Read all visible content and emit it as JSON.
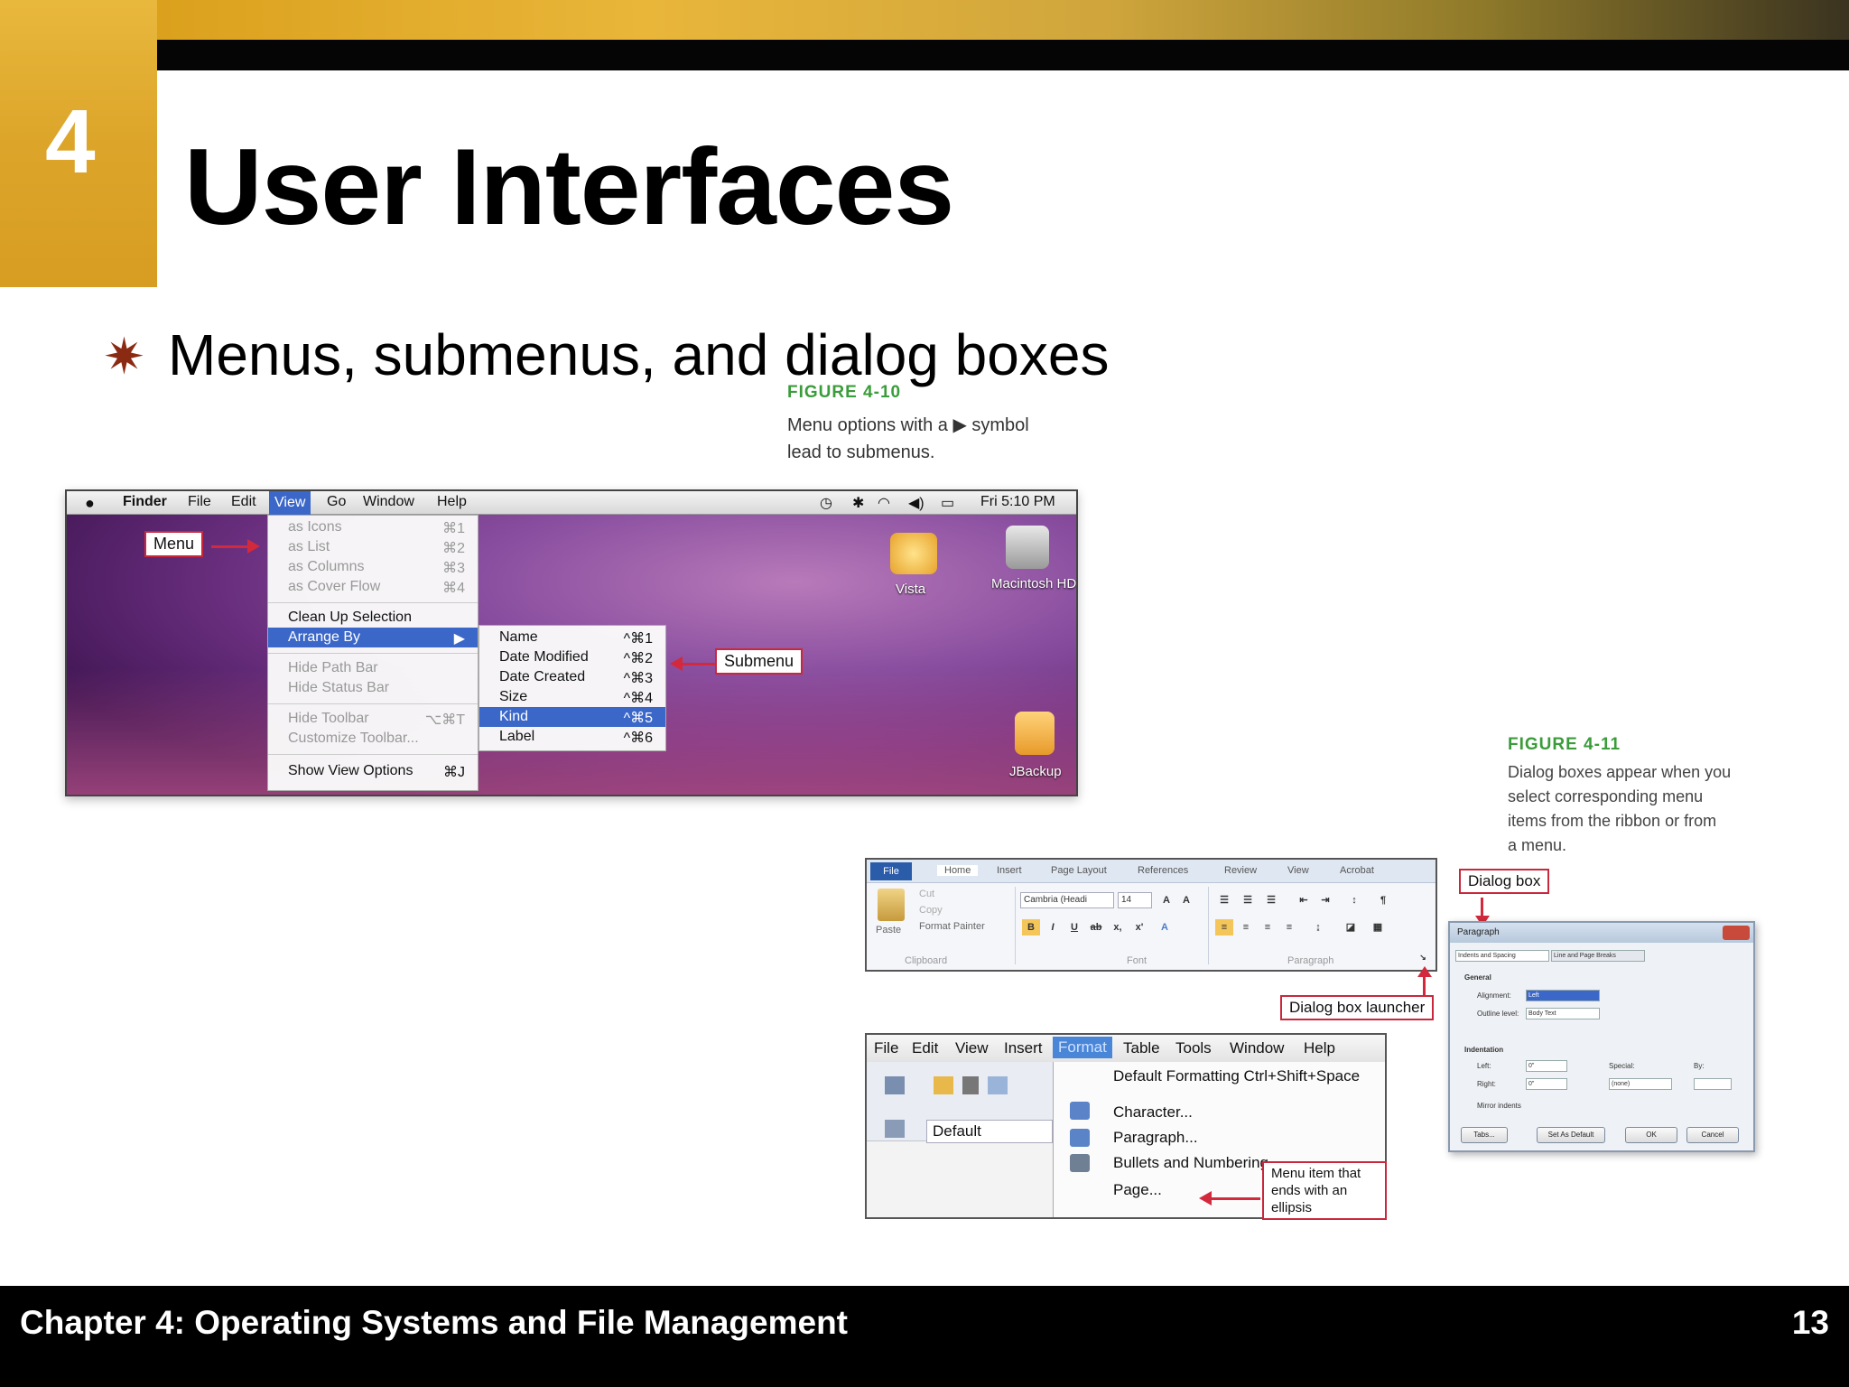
{
  "slide": {
    "chapter_number": "4",
    "title": "User Interfaces",
    "bullet": "Menus, submenus, and dialog boxes",
    "footer_text": "Chapter 4: Operating Systems and File Management",
    "page_number": "13"
  },
  "colors": {
    "gold": "#dca52a",
    "black": "#050505",
    "bullet_accent": "#8b2a12",
    "figure_label_green": "#3a9c3a",
    "callout_red": "#c8283c"
  },
  "figure_4_10": {
    "label": "FIGURE 4-10",
    "caption_line1": "Menu options with a ▶ symbol",
    "caption_line2": "lead to submenus.",
    "menubar": {
      "apple": "",
      "items": [
        "Finder",
        "File",
        "Edit",
        "View",
        "Go",
        "Window",
        "Help"
      ],
      "clock": "Fri 5:10 PM",
      "status_icons": [
        "time-machine-icon",
        "bluetooth-icon",
        "wifi-icon",
        "volume-icon",
        "battery-icon"
      ]
    },
    "view_menu": {
      "items": [
        {
          "label": "as Icons",
          "shortcut": "⌘1"
        },
        {
          "label": "as List",
          "shortcut": "⌘2"
        },
        {
          "label": "as Columns",
          "shortcut": "⌘3"
        },
        {
          "label": "as Cover Flow",
          "shortcut": "⌘4"
        },
        {
          "label": "Clean Up Selection",
          "shortcut": ""
        },
        {
          "label": "Arrange By",
          "shortcut": "▶"
        },
        {
          "label": "Hide Path Bar",
          "shortcut": ""
        },
        {
          "label": "Hide Status Bar",
          "shortcut": ""
        },
        {
          "label": "Hide Toolbar",
          "shortcut": "⌥⌘T"
        },
        {
          "label": "Customize Toolbar...",
          "shortcut": ""
        },
        {
          "label": "Show View Options",
          "shortcut": "⌘J"
        }
      ]
    },
    "arrange_submenu": {
      "items": [
        {
          "label": "Name",
          "shortcut": "^⌘1"
        },
        {
          "label": "Date Modified",
          "shortcut": "^⌘2"
        },
        {
          "label": "Date Created",
          "shortcut": "^⌘3"
        },
        {
          "label": "Size",
          "shortcut": "^⌘4"
        },
        {
          "label": "Kind",
          "shortcut": "^⌘5"
        },
        {
          "label": "Label",
          "shortcut": "^⌘6"
        }
      ]
    },
    "desktop_icons": [
      "Vista",
      "Macintosh HD",
      "JBackup"
    ],
    "callout_menu": "Menu",
    "callout_submenu": "Submenu"
  },
  "figure_4_11": {
    "label": "FIGURE 4-11",
    "caption_line1": "Dialog boxes appear when you",
    "caption_line2": "select corresponding menu",
    "caption_line3": "items from the ribbon or from",
    "caption_line4": "a menu.",
    "ribbon": {
      "file_tab": "File",
      "tabs": [
        "Home",
        "Insert",
        "Page Layout",
        "References",
        "Review",
        "View",
        "Acrobat"
      ],
      "paste": "Paste",
      "cut": "Cut",
      "copy": "Copy",
      "format_painter": "Format Painter",
      "font_name": "Cambria (Headi",
      "font_size": "14",
      "group_clipboard": "Clipboard",
      "group_font": "Font",
      "group_paragraph": "Paragraph"
    },
    "callout_dialog_box": "Dialog box",
    "callout_dialog_launcher": "Dialog box launcher",
    "dialog": {
      "title": "Paragraph",
      "tab1": "Indents and Spacing",
      "tab2": "Line and Page Breaks",
      "section_general": "General",
      "alignment_label": "Alignment:",
      "alignment_value": "Left",
      "outline_label": "Outline level:",
      "outline_value": "Body Text",
      "section_indentation": "Indentation",
      "left_label": "Left:",
      "left_value": "0\"",
      "right_label": "Right:",
      "right_value": "0\"",
      "special_label": "Special:",
      "special_value": "(none)",
      "by_label": "By:",
      "mirror_label": "Mirror indents",
      "btn_tabs": "Tabs...",
      "btn_default": "Set As Default",
      "btn_ok": "OK",
      "btn_cancel": "Cancel"
    },
    "office_menu": {
      "menubar": [
        "File",
        "Edit",
        "View",
        "Insert",
        "Format",
        "Table",
        "Tools",
        "Window",
        "Help"
      ],
      "style_box": "Default",
      "items": [
        "Default Formatting  Ctrl+Shift+Space",
        "Character...",
        "Paragraph...",
        "Bullets and Numbering...",
        "Page..."
      ]
    },
    "callout_ellipsis": "Menu item that ends with an ellipsis"
  }
}
